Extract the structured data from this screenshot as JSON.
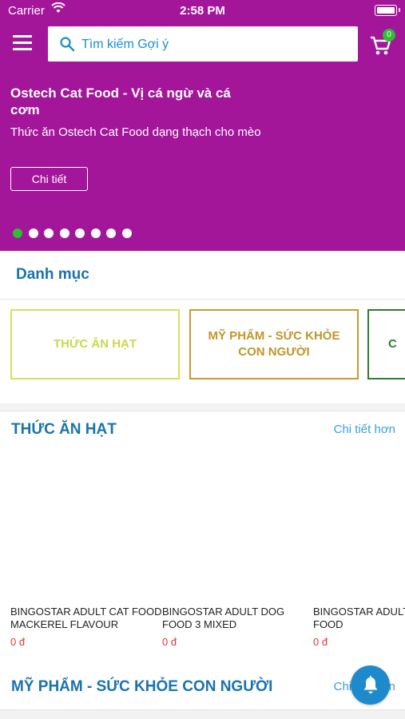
{
  "status_bar": {
    "carrier": "Carrier",
    "time": "2:58 PM"
  },
  "search": {
    "placeholder": "Tìm kiếm Gợi ý"
  },
  "cart": {
    "count": "0"
  },
  "banner": {
    "title": "Ostech Cat Food - Vị cá ngừ và cá cơm",
    "description": "Thức ăn Ostech Cat Food dạng thạch cho mèo",
    "button_label": "Chi tiết",
    "slide_count": 8,
    "active_slide": 1
  },
  "categories": {
    "title": "Danh mục",
    "items": [
      {
        "label": "THỨC ĂN HẠT",
        "color": "#d2e35a"
      },
      {
        "label": "MỸ PHẨM - SỨC KHỎE CON NGƯỜI",
        "color": "#c69a2c"
      },
      {
        "label": "C",
        "color": "#2f7d2f"
      }
    ]
  },
  "section_food": {
    "title": "THỨC ĂN HẠT",
    "more_label": "Chi tiết hơn",
    "products": [
      {
        "name": "BINGOSTAR ADULT CAT FOOD MACKEREL FLAVOUR",
        "price": "0 đ"
      },
      {
        "name": "BINGOSTAR ADULT DOG FOOD 3 MIXED",
        "price": "0 đ"
      },
      {
        "name": "BINGOSTAR ADULT FOOD",
        "price": "0 đ"
      }
    ]
  },
  "section_cosmetics": {
    "title": "MỸ PHẨM - SỨC KHỎE CON NGƯỜI",
    "more_label": "Chi tiết hơn"
  },
  "colors": {
    "brand": "#a3169a",
    "heading": "#1a73ad",
    "link": "#3aa0d8",
    "price": "#e33333",
    "badge": "#2ebd33"
  }
}
